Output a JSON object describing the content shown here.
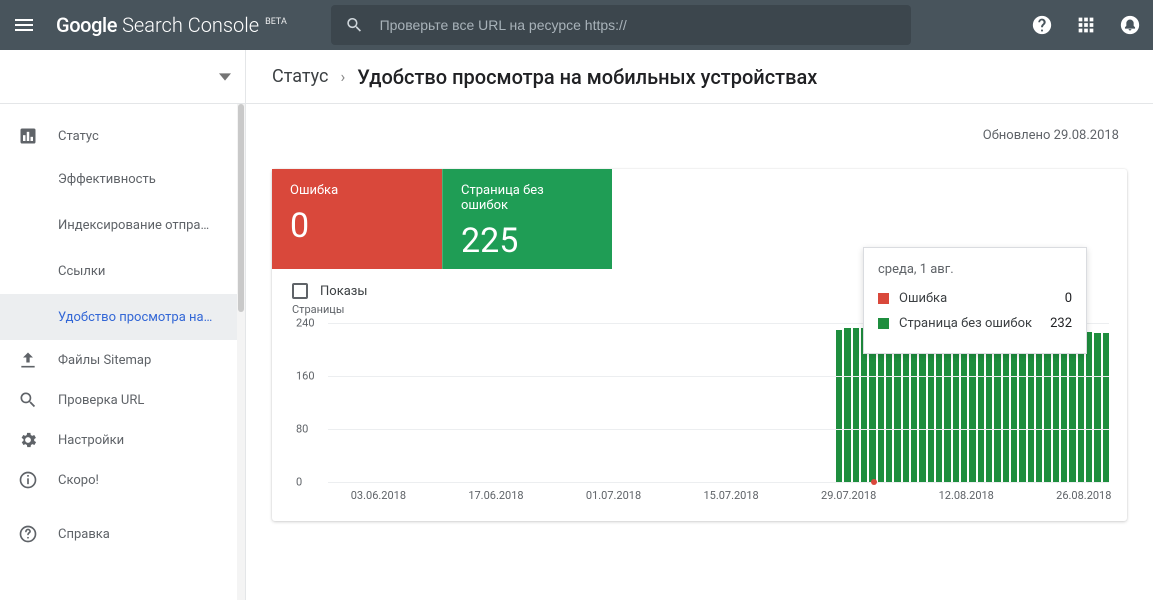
{
  "topbar": {
    "logo_google": "Google",
    "logo_product": "Search Console",
    "logo_beta": "BETA",
    "search_placeholder": "Проверьте все URL на ресурсе https://"
  },
  "sidebar": {
    "items": [
      {
        "label": "Статус",
        "icon": "bar-chart-icon"
      },
      {
        "label": "Файлы Sitemap",
        "icon": "upload-icon"
      },
      {
        "label": "Проверка URL",
        "icon": "search-icon"
      },
      {
        "label": "Настройки",
        "icon": "gear-icon"
      },
      {
        "label": "Скоро!",
        "icon": "info-icon"
      },
      {
        "label": "Справка",
        "icon": "help-icon"
      }
    ],
    "status_children": [
      {
        "label": "Эффективность"
      },
      {
        "label": "Индексирование отпра…"
      },
      {
        "label": "Ссылки"
      },
      {
        "label": "Удобство просмотра на…"
      }
    ]
  },
  "breadcrumb": {
    "root": "Статус",
    "current": "Удобство просмотра на мобильных устройствах"
  },
  "updated_label": "Обновлено 29.08.2018",
  "tabs": {
    "error": {
      "label": "Ошибка",
      "value": "0"
    },
    "valid": {
      "label": "Страница без ошибок",
      "value": "225"
    }
  },
  "controls": {
    "checkbox_label": "Показы"
  },
  "tooltip": {
    "date": "среда, 1 авг.",
    "rows": [
      {
        "label": "Ошибка",
        "value": "0",
        "color": "red"
      },
      {
        "label": "Страница без ошибок",
        "value": "232",
        "color": "green"
      }
    ]
  },
  "chart_data": {
    "type": "bar",
    "title": "",
    "xlabel": "",
    "ylabel": "Страницы",
    "ylim": [
      0,
      240
    ],
    "yticks": [
      0,
      80,
      160,
      240
    ],
    "xticks": [
      "03.06.2018",
      "17.06.2018",
      "01.07.2018",
      "15.07.2018",
      "29.07.2018",
      "12.08.2018",
      "26.08.2018"
    ],
    "series": [
      {
        "name": "Страница без ошибок",
        "color": "#1e8e3e",
        "dates": [
          "28.05.2018",
          "29.05.2018",
          "30.05.2018",
          "31.05.2018",
          "01.06.2018",
          "02.06.2018",
          "03.06.2018",
          "04.06.2018",
          "05.06.2018",
          "06.06.2018",
          "07.06.2018",
          "08.06.2018",
          "09.06.2018",
          "10.06.2018",
          "11.06.2018",
          "12.06.2018",
          "13.06.2018",
          "14.06.2018",
          "15.06.2018",
          "16.06.2018",
          "17.06.2018",
          "18.06.2018",
          "19.06.2018",
          "20.06.2018",
          "21.06.2018",
          "22.06.2018",
          "23.06.2018",
          "24.06.2018",
          "25.06.2018",
          "26.06.2018",
          "27.06.2018",
          "28.06.2018",
          "29.06.2018",
          "30.06.2018",
          "01.07.2018",
          "02.07.2018",
          "03.07.2018",
          "04.07.2018",
          "05.07.2018",
          "06.07.2018",
          "07.07.2018",
          "08.07.2018",
          "09.07.2018",
          "10.07.2018",
          "11.07.2018",
          "12.07.2018",
          "13.07.2018",
          "14.07.2018",
          "15.07.2018",
          "16.07.2018",
          "17.07.2018",
          "18.07.2018",
          "19.07.2018",
          "20.07.2018",
          "21.07.2018",
          "22.07.2018",
          "23.07.2018",
          "24.07.2018",
          "25.07.2018",
          "26.07.2018",
          "27.07.2018",
          "28.07.2018",
          "29.07.2018",
          "30.07.2018",
          "31.07.2018",
          "01.08.2018",
          "02.08.2018",
          "03.08.2018",
          "04.08.2018",
          "05.08.2018",
          "06.08.2018",
          "07.08.2018",
          "08.08.2018",
          "09.08.2018",
          "10.08.2018",
          "11.08.2018",
          "12.08.2018",
          "13.08.2018",
          "14.08.2018",
          "15.08.2018",
          "16.08.2018",
          "17.08.2018",
          "18.08.2018",
          "19.08.2018",
          "20.08.2018",
          "21.08.2018",
          "22.08.2018",
          "23.08.2018",
          "24.08.2018",
          "25.08.2018",
          "26.08.2018",
          "27.08.2018",
          "28.08.2018",
          "29.08.2018"
        ],
        "values": [
          0,
          0,
          0,
          0,
          0,
          0,
          0,
          0,
          0,
          0,
          0,
          0,
          0,
          0,
          0,
          0,
          0,
          0,
          0,
          0,
          0,
          0,
          0,
          0,
          0,
          0,
          0,
          0,
          0,
          0,
          0,
          0,
          0,
          0,
          0,
          0,
          0,
          0,
          0,
          0,
          0,
          0,
          0,
          0,
          0,
          0,
          0,
          0,
          0,
          0,
          0,
          0,
          0,
          0,
          0,
          0,
          0,
          0,
          0,
          0,
          0,
          230,
          232,
          233,
          233,
          232,
          234,
          232,
          231,
          232,
          233,
          233,
          232,
          231,
          232,
          232,
          232,
          231,
          230,
          230,
          230,
          229,
          229,
          228,
          229,
          229,
          228,
          228,
          228,
          227,
          227,
          226,
          225,
          225
        ]
      },
      {
        "name": "Ошибка",
        "color": "#d9483b",
        "dates": [
          "01.08.2018"
        ],
        "values": [
          1
        ]
      }
    ]
  }
}
